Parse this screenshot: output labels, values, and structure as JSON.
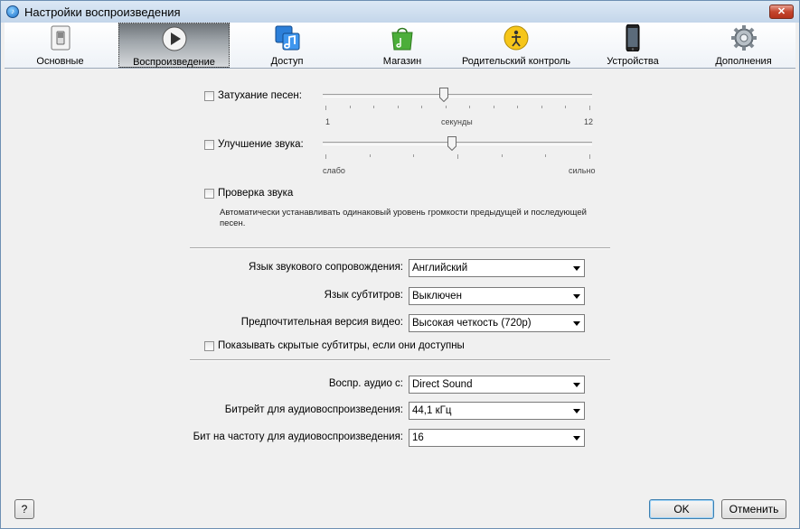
{
  "window": {
    "title": "Настройки воспроизведения",
    "close_label": "✕"
  },
  "toolbar": {
    "items": [
      {
        "label": "Основные",
        "icon": "switch-icon"
      },
      {
        "label": "Воспроизведение",
        "icon": "play-icon"
      },
      {
        "label": "Доступ",
        "icon": "music-notes-icon"
      },
      {
        "label": "Магазин",
        "icon": "shopping-bag-icon"
      },
      {
        "label": "Родительский контроль",
        "icon": "parental-control-icon"
      },
      {
        "label": "Устройства",
        "icon": "phone-icon"
      },
      {
        "label": "Дополнения",
        "icon": "gear-icon"
      }
    ]
  },
  "crossfade": {
    "label": "Затухание песен:",
    "min": "1",
    "mid": "секунды",
    "max": "12",
    "slider_fraction": 0.45
  },
  "sound_enhancer": {
    "label": "Улучшение звука:",
    "min": "слабо",
    "max": "сильно",
    "slider_fraction": 0.48
  },
  "sound_check": {
    "label": "Проверка звука",
    "description": "Автоматически устанавливать одинаковый уровень громкости предыдущей и последующей песен."
  },
  "audio_language": {
    "label": "Язык звукового сопровождения:",
    "value": "Английский"
  },
  "subtitle_language": {
    "label": "Язык субтитров:",
    "value": "Выключен"
  },
  "video_version": {
    "label": "Предпочтительная версия видео:",
    "value": "Высокая четкость (720p)"
  },
  "closed_captions": {
    "label": "Показывать скрытые субтитры, если они доступны"
  },
  "play_audio_using": {
    "label": "Воспр. аудио с:",
    "value": "Direct Sound"
  },
  "sample_rate": {
    "label": "Битрейт для аудиовоспроизведения:",
    "value": "44,1 кГц"
  },
  "bits_per_sample": {
    "label": "Бит на частоту для аудиовоспроизведения:",
    "value": "16"
  },
  "footer": {
    "help_label": "?",
    "ok_label": "OK",
    "cancel_label": "Отменить"
  }
}
